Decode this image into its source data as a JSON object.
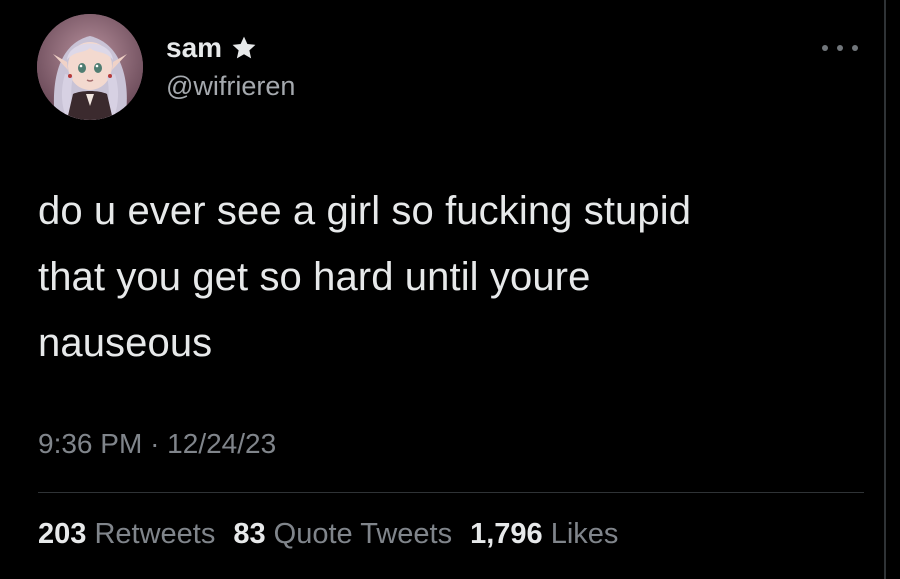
{
  "user": {
    "display_name": "sam",
    "handle": "@wifrieren",
    "badge_icon": "star-icon",
    "avatar_icon": "anime-girl-avatar"
  },
  "tweet": {
    "text": "do u ever see a girl so fucking stupid\nthat you get so hard until youre\nnauseous",
    "time": "9:36 PM",
    "separator": "·",
    "date": "12/24/23"
  },
  "stats": {
    "retweets_count": "203",
    "retweets_label": "Retweets",
    "quotes_count": "83",
    "quotes_label": "Quote Tweets",
    "likes_count": "1,796",
    "likes_label": "Likes"
  },
  "colors": {
    "background": "#000000",
    "primary_text": "#e7e9ea",
    "secondary_text": "#80858b",
    "divider": "#2f3336"
  }
}
